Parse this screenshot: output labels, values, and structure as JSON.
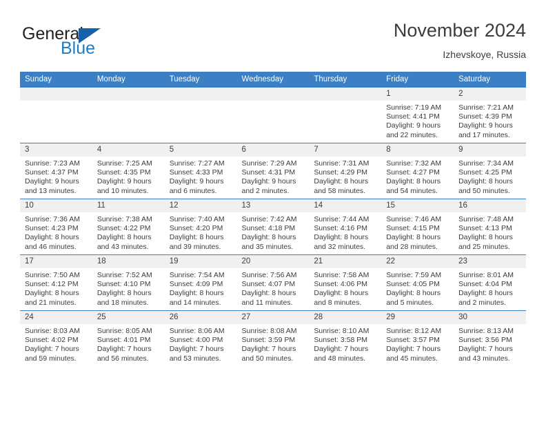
{
  "brand": {
    "name_part1": "General",
    "name_part2": "Blue",
    "accent_color": "#1d7cc4",
    "triangle_color": "#1562a8"
  },
  "header": {
    "title": "November 2024",
    "subtitle": "Izhevskoye, Russia"
  },
  "theme": {
    "header_blue": "#3b7fc4",
    "daynum_bg": "#f0f0f0",
    "text": "#3c3c3c"
  },
  "weekdays": [
    "Sunday",
    "Monday",
    "Tuesday",
    "Wednesday",
    "Thursday",
    "Friday",
    "Saturday"
  ],
  "labels": {
    "sunrise_prefix": "Sunrise:",
    "sunset_prefix": "Sunset:",
    "daylight_prefix": "Daylight:"
  },
  "weeks": [
    [
      {
        "day": "",
        "empty": true
      },
      {
        "day": "",
        "empty": true
      },
      {
        "day": "",
        "empty": true
      },
      {
        "day": "",
        "empty": true
      },
      {
        "day": "",
        "empty": true
      },
      {
        "day": "1",
        "sunrise": "Sunrise: 7:19 AM",
        "sunset": "Sunset: 4:41 PM",
        "daylight_line1": "Daylight: 9 hours",
        "daylight_line2": "and 22 minutes."
      },
      {
        "day": "2",
        "sunrise": "Sunrise: 7:21 AM",
        "sunset": "Sunset: 4:39 PM",
        "daylight_line1": "Daylight: 9 hours",
        "daylight_line2": "and 17 minutes."
      }
    ],
    [
      {
        "day": "3",
        "sunrise": "Sunrise: 7:23 AM",
        "sunset": "Sunset: 4:37 PM",
        "daylight_line1": "Daylight: 9 hours",
        "daylight_line2": "and 13 minutes."
      },
      {
        "day": "4",
        "sunrise": "Sunrise: 7:25 AM",
        "sunset": "Sunset: 4:35 PM",
        "daylight_line1": "Daylight: 9 hours",
        "daylight_line2": "and 10 minutes."
      },
      {
        "day": "5",
        "sunrise": "Sunrise: 7:27 AM",
        "sunset": "Sunset: 4:33 PM",
        "daylight_line1": "Daylight: 9 hours",
        "daylight_line2": "and 6 minutes."
      },
      {
        "day": "6",
        "sunrise": "Sunrise: 7:29 AM",
        "sunset": "Sunset: 4:31 PM",
        "daylight_line1": "Daylight: 9 hours",
        "daylight_line2": "and 2 minutes."
      },
      {
        "day": "7",
        "sunrise": "Sunrise: 7:31 AM",
        "sunset": "Sunset: 4:29 PM",
        "daylight_line1": "Daylight: 8 hours",
        "daylight_line2": "and 58 minutes."
      },
      {
        "day": "8",
        "sunrise": "Sunrise: 7:32 AM",
        "sunset": "Sunset: 4:27 PM",
        "daylight_line1": "Daylight: 8 hours",
        "daylight_line2": "and 54 minutes."
      },
      {
        "day": "9",
        "sunrise": "Sunrise: 7:34 AM",
        "sunset": "Sunset: 4:25 PM",
        "daylight_line1": "Daylight: 8 hours",
        "daylight_line2": "and 50 minutes."
      }
    ],
    [
      {
        "day": "10",
        "sunrise": "Sunrise: 7:36 AM",
        "sunset": "Sunset: 4:23 PM",
        "daylight_line1": "Daylight: 8 hours",
        "daylight_line2": "and 46 minutes."
      },
      {
        "day": "11",
        "sunrise": "Sunrise: 7:38 AM",
        "sunset": "Sunset: 4:22 PM",
        "daylight_line1": "Daylight: 8 hours",
        "daylight_line2": "and 43 minutes."
      },
      {
        "day": "12",
        "sunrise": "Sunrise: 7:40 AM",
        "sunset": "Sunset: 4:20 PM",
        "daylight_line1": "Daylight: 8 hours",
        "daylight_line2": "and 39 minutes."
      },
      {
        "day": "13",
        "sunrise": "Sunrise: 7:42 AM",
        "sunset": "Sunset: 4:18 PM",
        "daylight_line1": "Daylight: 8 hours",
        "daylight_line2": "and 35 minutes."
      },
      {
        "day": "14",
        "sunrise": "Sunrise: 7:44 AM",
        "sunset": "Sunset: 4:16 PM",
        "daylight_line1": "Daylight: 8 hours",
        "daylight_line2": "and 32 minutes."
      },
      {
        "day": "15",
        "sunrise": "Sunrise: 7:46 AM",
        "sunset": "Sunset: 4:15 PM",
        "daylight_line1": "Daylight: 8 hours",
        "daylight_line2": "and 28 minutes."
      },
      {
        "day": "16",
        "sunrise": "Sunrise: 7:48 AM",
        "sunset": "Sunset: 4:13 PM",
        "daylight_line1": "Daylight: 8 hours",
        "daylight_line2": "and 25 minutes."
      }
    ],
    [
      {
        "day": "17",
        "sunrise": "Sunrise: 7:50 AM",
        "sunset": "Sunset: 4:12 PM",
        "daylight_line1": "Daylight: 8 hours",
        "daylight_line2": "and 21 minutes."
      },
      {
        "day": "18",
        "sunrise": "Sunrise: 7:52 AM",
        "sunset": "Sunset: 4:10 PM",
        "daylight_line1": "Daylight: 8 hours",
        "daylight_line2": "and 18 minutes."
      },
      {
        "day": "19",
        "sunrise": "Sunrise: 7:54 AM",
        "sunset": "Sunset: 4:09 PM",
        "daylight_line1": "Daylight: 8 hours",
        "daylight_line2": "and 14 minutes."
      },
      {
        "day": "20",
        "sunrise": "Sunrise: 7:56 AM",
        "sunset": "Sunset: 4:07 PM",
        "daylight_line1": "Daylight: 8 hours",
        "daylight_line2": "and 11 minutes."
      },
      {
        "day": "21",
        "sunrise": "Sunrise: 7:58 AM",
        "sunset": "Sunset: 4:06 PM",
        "daylight_line1": "Daylight: 8 hours",
        "daylight_line2": "and 8 minutes."
      },
      {
        "day": "22",
        "sunrise": "Sunrise: 7:59 AM",
        "sunset": "Sunset: 4:05 PM",
        "daylight_line1": "Daylight: 8 hours",
        "daylight_line2": "and 5 minutes."
      },
      {
        "day": "23",
        "sunrise": "Sunrise: 8:01 AM",
        "sunset": "Sunset: 4:04 PM",
        "daylight_line1": "Daylight: 8 hours",
        "daylight_line2": "and 2 minutes."
      }
    ],
    [
      {
        "day": "24",
        "sunrise": "Sunrise: 8:03 AM",
        "sunset": "Sunset: 4:02 PM",
        "daylight_line1": "Daylight: 7 hours",
        "daylight_line2": "and 59 minutes."
      },
      {
        "day": "25",
        "sunrise": "Sunrise: 8:05 AM",
        "sunset": "Sunset: 4:01 PM",
        "daylight_line1": "Daylight: 7 hours",
        "daylight_line2": "and 56 minutes."
      },
      {
        "day": "26",
        "sunrise": "Sunrise: 8:06 AM",
        "sunset": "Sunset: 4:00 PM",
        "daylight_line1": "Daylight: 7 hours",
        "daylight_line2": "and 53 minutes."
      },
      {
        "day": "27",
        "sunrise": "Sunrise: 8:08 AM",
        "sunset": "Sunset: 3:59 PM",
        "daylight_line1": "Daylight: 7 hours",
        "daylight_line2": "and 50 minutes."
      },
      {
        "day": "28",
        "sunrise": "Sunrise: 8:10 AM",
        "sunset": "Sunset: 3:58 PM",
        "daylight_line1": "Daylight: 7 hours",
        "daylight_line2": "and 48 minutes."
      },
      {
        "day": "29",
        "sunrise": "Sunrise: 8:12 AM",
        "sunset": "Sunset: 3:57 PM",
        "daylight_line1": "Daylight: 7 hours",
        "daylight_line2": "and 45 minutes."
      },
      {
        "day": "30",
        "sunrise": "Sunrise: 8:13 AM",
        "sunset": "Sunset: 3:56 PM",
        "daylight_line1": "Daylight: 7 hours",
        "daylight_line2": "and 43 minutes."
      }
    ]
  ]
}
